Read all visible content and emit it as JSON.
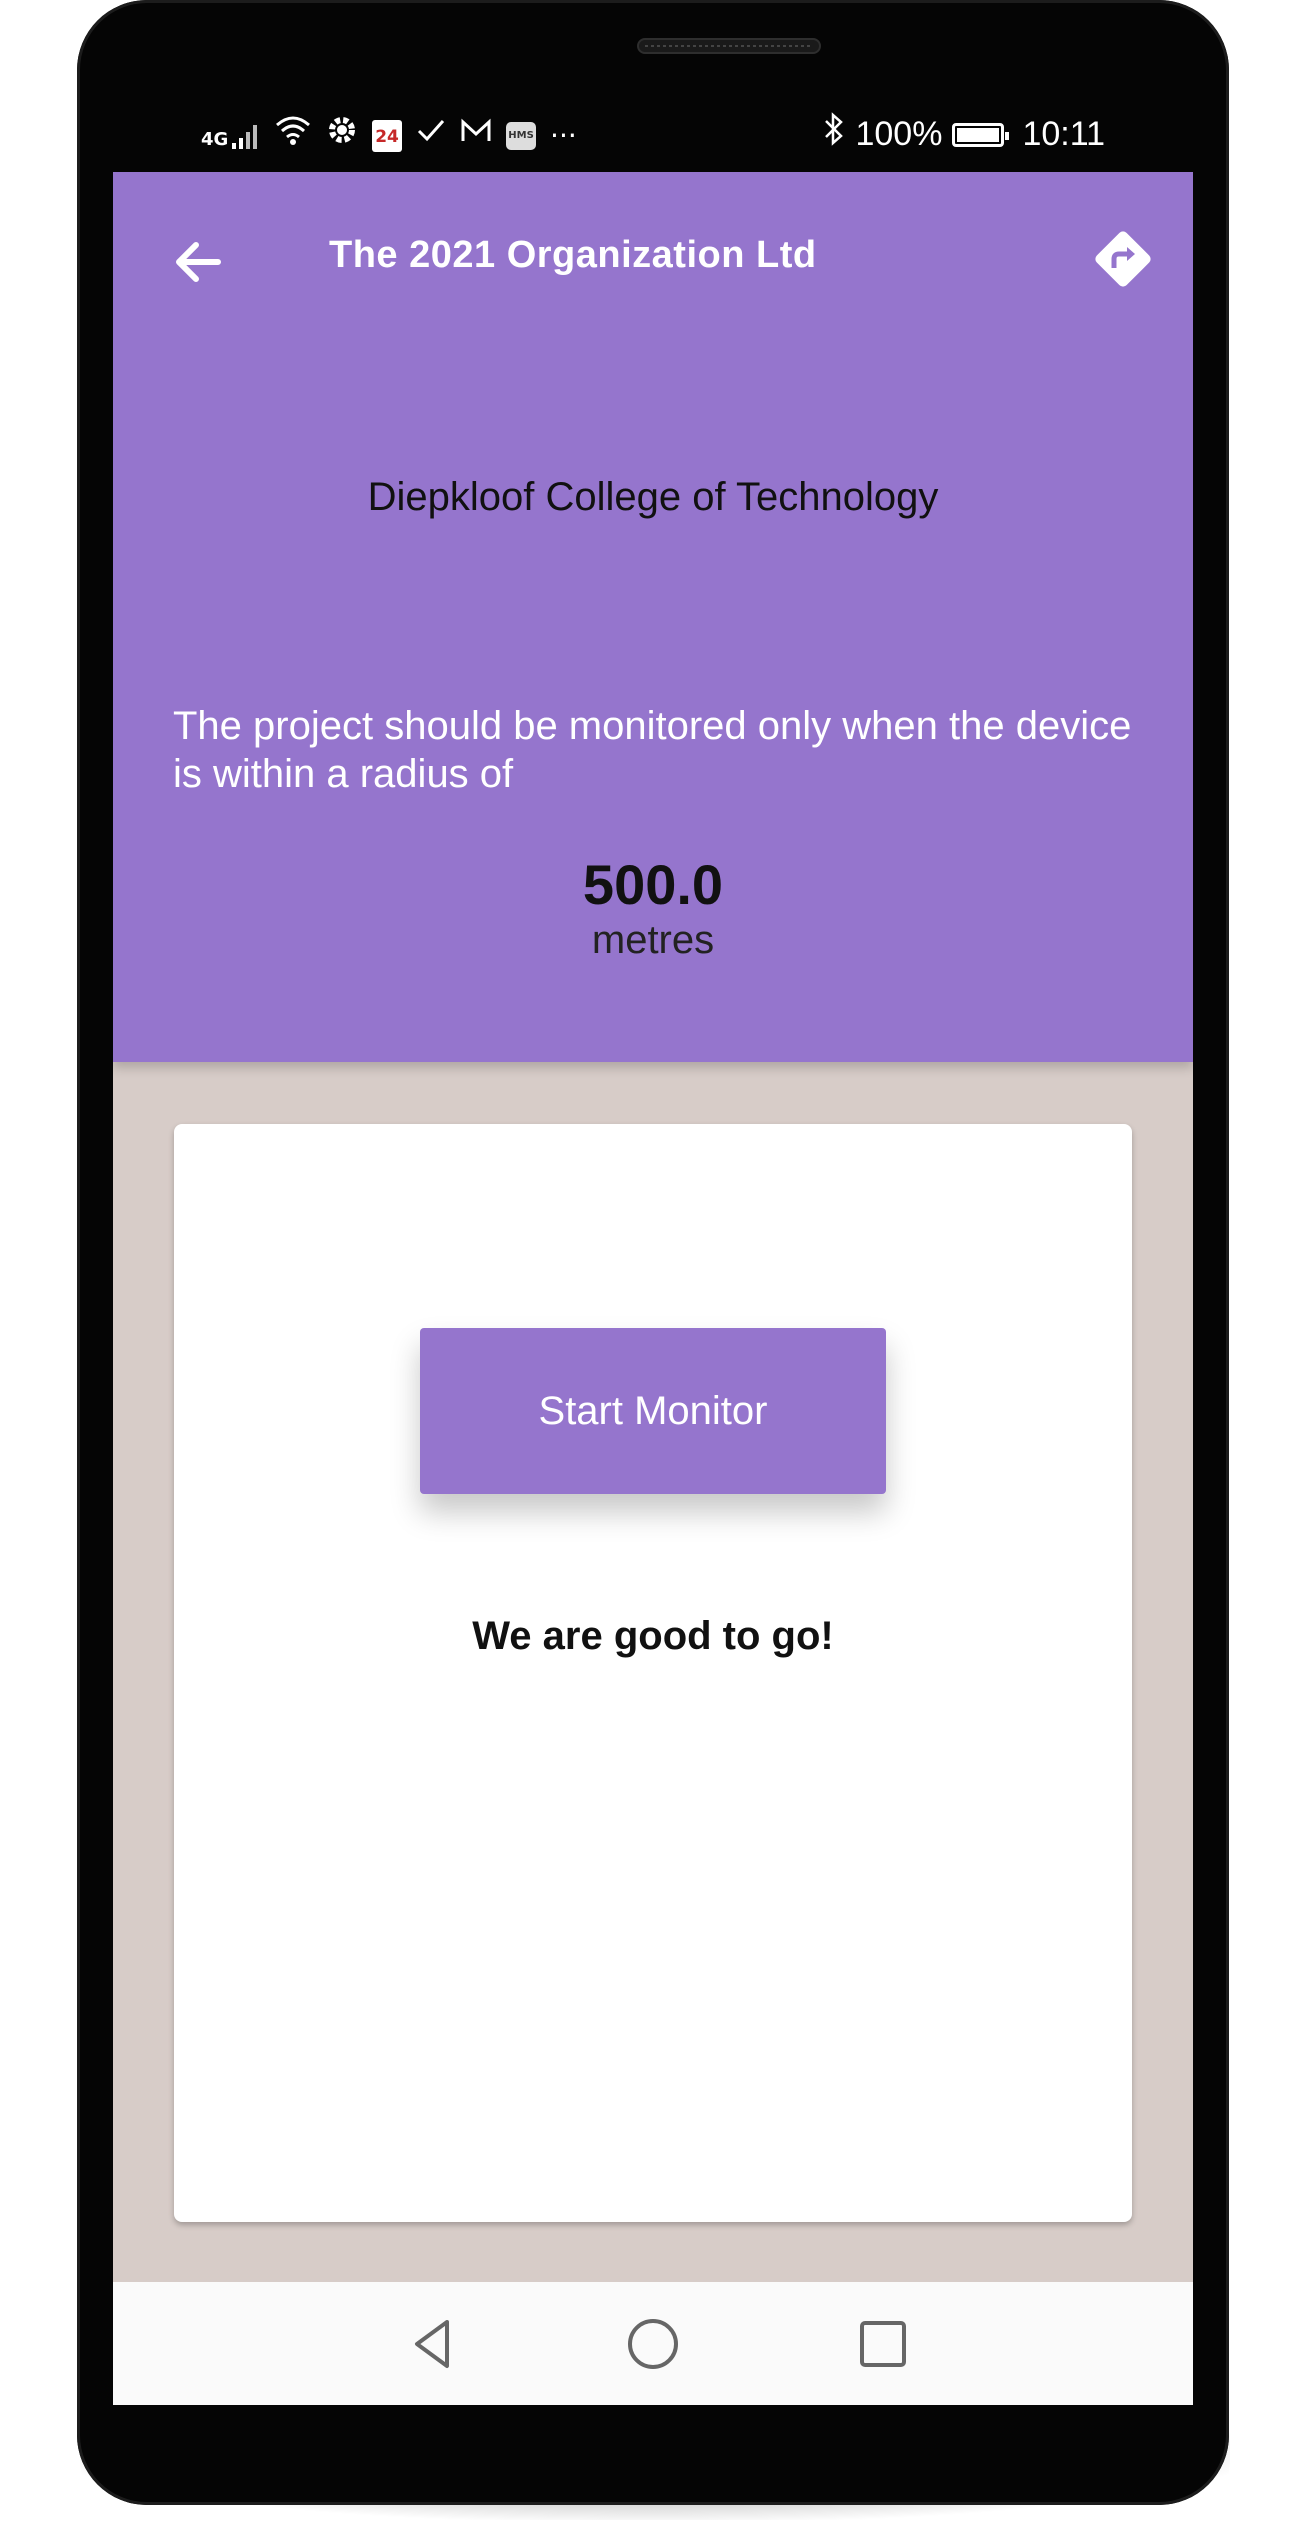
{
  "status_bar": {
    "network": "4G",
    "battery": "100%",
    "time": "10:11",
    "calendar_day": "24",
    "hms_label": "HMS",
    "more": "···",
    "icons": [
      "signal-icon",
      "wifi-icon",
      "settings-icon",
      "calendar-icon",
      "check-icon",
      "mail-icon",
      "hms-icon",
      "more-icon",
      "bluetooth-icon",
      "battery-icon"
    ]
  },
  "app_bar": {
    "title": "The 2021 Organization Ltd",
    "back_icon": "arrow-left-icon",
    "directions_icon": "directions-icon"
  },
  "project": {
    "name": "Diepkloof College of Technology",
    "description": "The project should be monitored only when the device is within a radius of",
    "radius_value": "500.0",
    "radius_unit": "metres"
  },
  "card": {
    "start_button": "Start Monitor",
    "status_message": "We are good to go!"
  },
  "nav_bar": {
    "icons": [
      "back-triangle-icon",
      "home-circle-icon",
      "recents-square-icon"
    ]
  },
  "colors": {
    "primary": "#9575cd",
    "background": "#d7ccc8",
    "card": "#ffffff"
  }
}
